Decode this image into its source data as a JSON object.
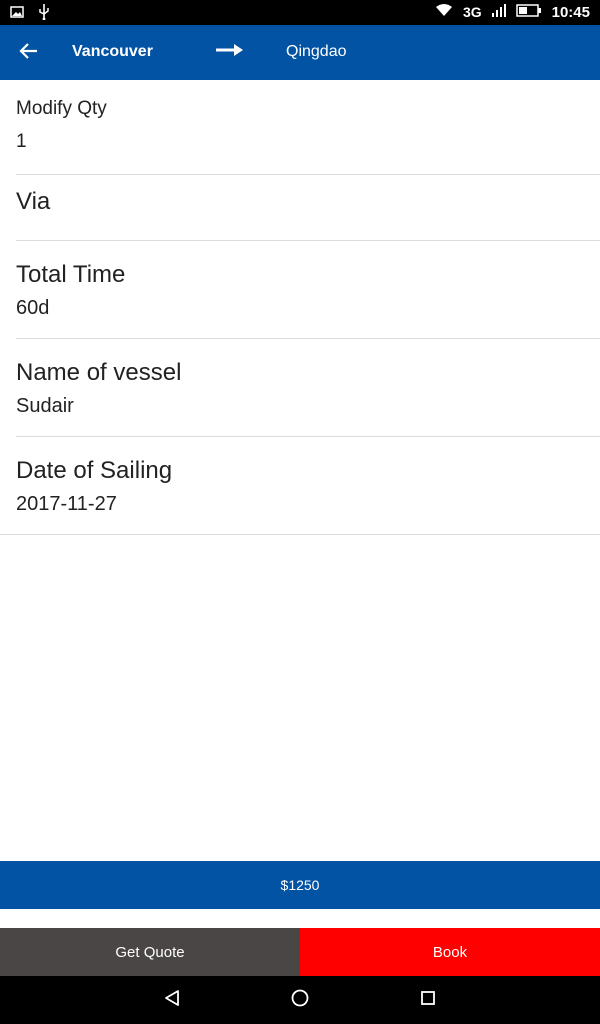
{
  "status_bar": {
    "time": "10:45",
    "network": "3G",
    "icons": [
      "image-icon",
      "usb-icon",
      "wifi-icon",
      "signal-icon",
      "battery-icon"
    ]
  },
  "app_bar": {
    "origin": "Vancouver",
    "destination": "Qingdao",
    "icons": [
      "back-arrow-icon",
      "route-arrow-icon"
    ]
  },
  "details": {
    "modify_qty": {
      "label": "Modify Qty",
      "value": "1"
    },
    "via": {
      "label": "Via",
      "value": ""
    },
    "total_time": {
      "label": "Total Time",
      "value": "60d"
    },
    "vessel": {
      "label": "Name of vessel",
      "value": "Sudair"
    },
    "sailing": {
      "label": "Date of Sailing",
      "value": "2017-11-27"
    }
  },
  "price": {
    "label": "$1250"
  },
  "actions": {
    "quote_label": "Get Quote",
    "book_label": "Book"
  },
  "nav_bar": {
    "icons": [
      "nav-back-icon",
      "nav-home-icon",
      "nav-recents-icon"
    ]
  },
  "colors": {
    "primary": "#0353a4",
    "book": "#ff0000",
    "quote": "#4a4646"
  }
}
